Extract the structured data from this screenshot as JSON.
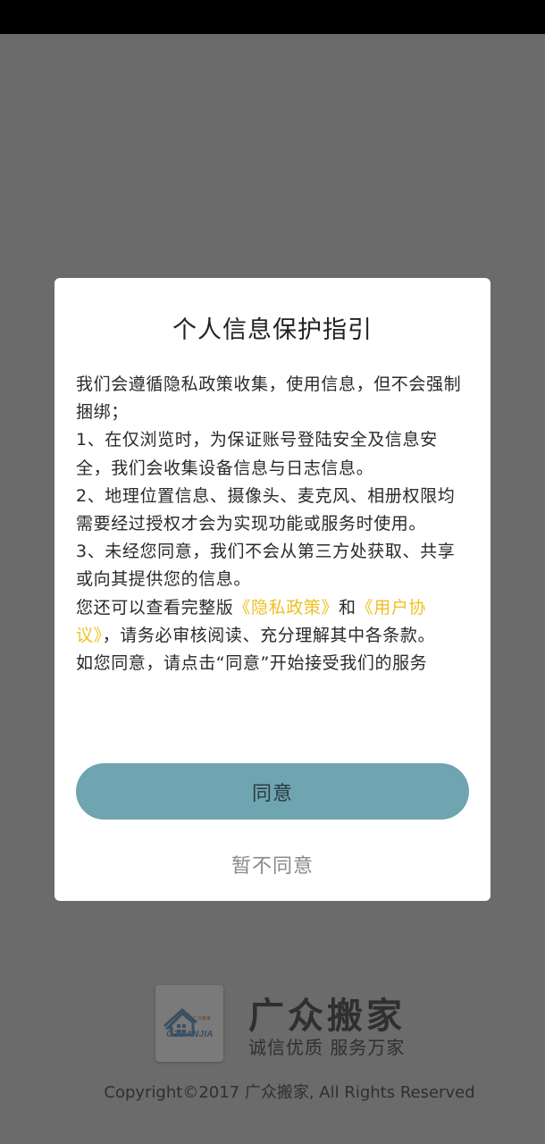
{
  "background": {
    "brand_name": "广众搬家",
    "slogan": "诚信优质 服务万家",
    "logo_text": "GZBANJIA",
    "logo_mini_cn": "广众搬家",
    "copyright": "Copyright©2017 广众搬家, All Rights Reserved"
  },
  "dialog": {
    "title": "个人信息保护指引",
    "para1": "我们会遵循隐私政策收集，使用信息，但不会强制捆绑；",
    "para2": "1、在仅浏览时，为保证账号登陆安全及信息安全，我们会收集设备信息与日志信息。",
    "para3": "2、地理位置信息、摄像头、麦克风、相册权限均需要经过授权才会为实现功能或服务时使用。",
    "para4": "3、未经您同意，我们不会从第三方处获取、共享或向其提供您的信息。",
    "para5_prefix": "您还可以查看完整版",
    "privacy_link": "《隐私政策》",
    "para5_and": "和",
    "user_agreement_link": "《用户协议》",
    "para5_suffix": "，请务必审核阅读、充分理解其中各条款。",
    "para6": "如您同意，请点击“同意”开始接受我们的服务",
    "agree_label": "同意",
    "disagree_label": "暂不同意"
  },
  "colors": {
    "overlay_bg": "#6b6b6b",
    "status_bar": "#000000",
    "dialog_bg": "#ffffff",
    "agree_button": "#6fa4b1",
    "link": "#f0c020",
    "disagree_text": "#8a8a8a"
  }
}
